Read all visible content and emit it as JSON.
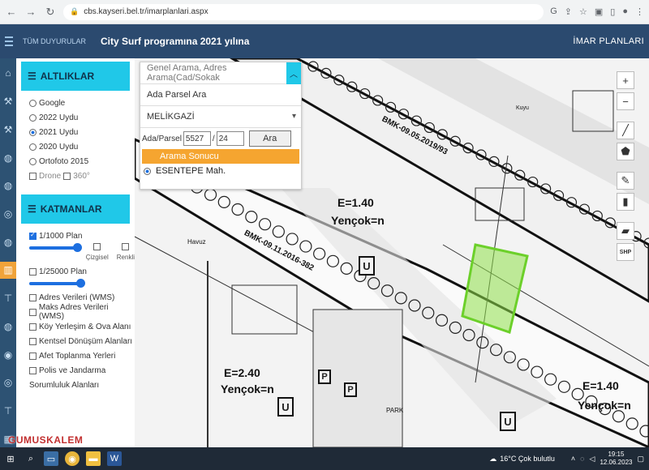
{
  "browser": {
    "url": "cbs.kayseri.bel.tr/imarplanlari.aspx"
  },
  "header": {
    "announcements": "TÜM DUYURULAR",
    "title": "City Surf programına 2021 yılına",
    "right_title": "İMAR PLANLARI"
  },
  "basemaps": {
    "title": "ALTLIKLAR",
    "items": [
      {
        "label": "Google",
        "selected": false
      },
      {
        "label": "2022 Uydu",
        "selected": false
      },
      {
        "label": "2021 Uydu",
        "selected": true
      },
      {
        "label": "2020 Uydu",
        "selected": false
      },
      {
        "label": "Ortofoto 2015",
        "selected": false
      }
    ],
    "drone_label": "Drone",
    "view360_label": "360°"
  },
  "layers": {
    "title": "KATMANLAR",
    "plan1000": "1/1000 Plan",
    "plan1000_checked": true,
    "cizgisel": "Çizgisel",
    "renkli": "Renkli",
    "plan25000": "1/25000 Plan",
    "items": [
      "Adres Verileri (WMS)",
      "Maks Adres Verileri (WMS)",
      "Köy Yerleşim & Ova Alanı",
      "Kentsel Dönüşüm Alanları",
      "Afet Toplanma Yerleri",
      "Polis ve Jandarma",
      "Sorumluluk Alanları"
    ]
  },
  "search": {
    "placeholder": "Genel Arama, Adres Arama(Cad/Sokak",
    "mode": "Ada Parsel Ara",
    "district": "MELİKGAZİ",
    "ada_parsel_label": "Ada/Parsel",
    "ada": "5527",
    "parsel": "24",
    "search_button": "Ara",
    "result_header": "Arama Sonucu",
    "result_item": "ESENTEPE Mah."
  },
  "map": {
    "labels": {
      "e140_a": "E=1.40",
      "yencok_a": "Yençok=n",
      "e240": "E=2.40",
      "yencok_b": "Yençok=n",
      "e140_b": "E=1.40",
      "yencok_c": "Yençok=n",
      "bmk_top": "BMK-09.05.2019/93",
      "bmk_mid": "BMK-09.11.2016-382",
      "havuz": "Havuz",
      "park": "PARK",
      "kuyu": "Kuyu",
      "u": "U",
      "p": "P"
    },
    "parcel_color": "#8fe04a"
  },
  "tools": {
    "zoom_in": "+",
    "zoom_out": "−",
    "shp": "SHP"
  },
  "taskbar": {
    "weather": "16°C Çok bulutlu",
    "time": "19:15",
    "date": "12.06.2023"
  },
  "watermark": "GUMUSKALEM"
}
